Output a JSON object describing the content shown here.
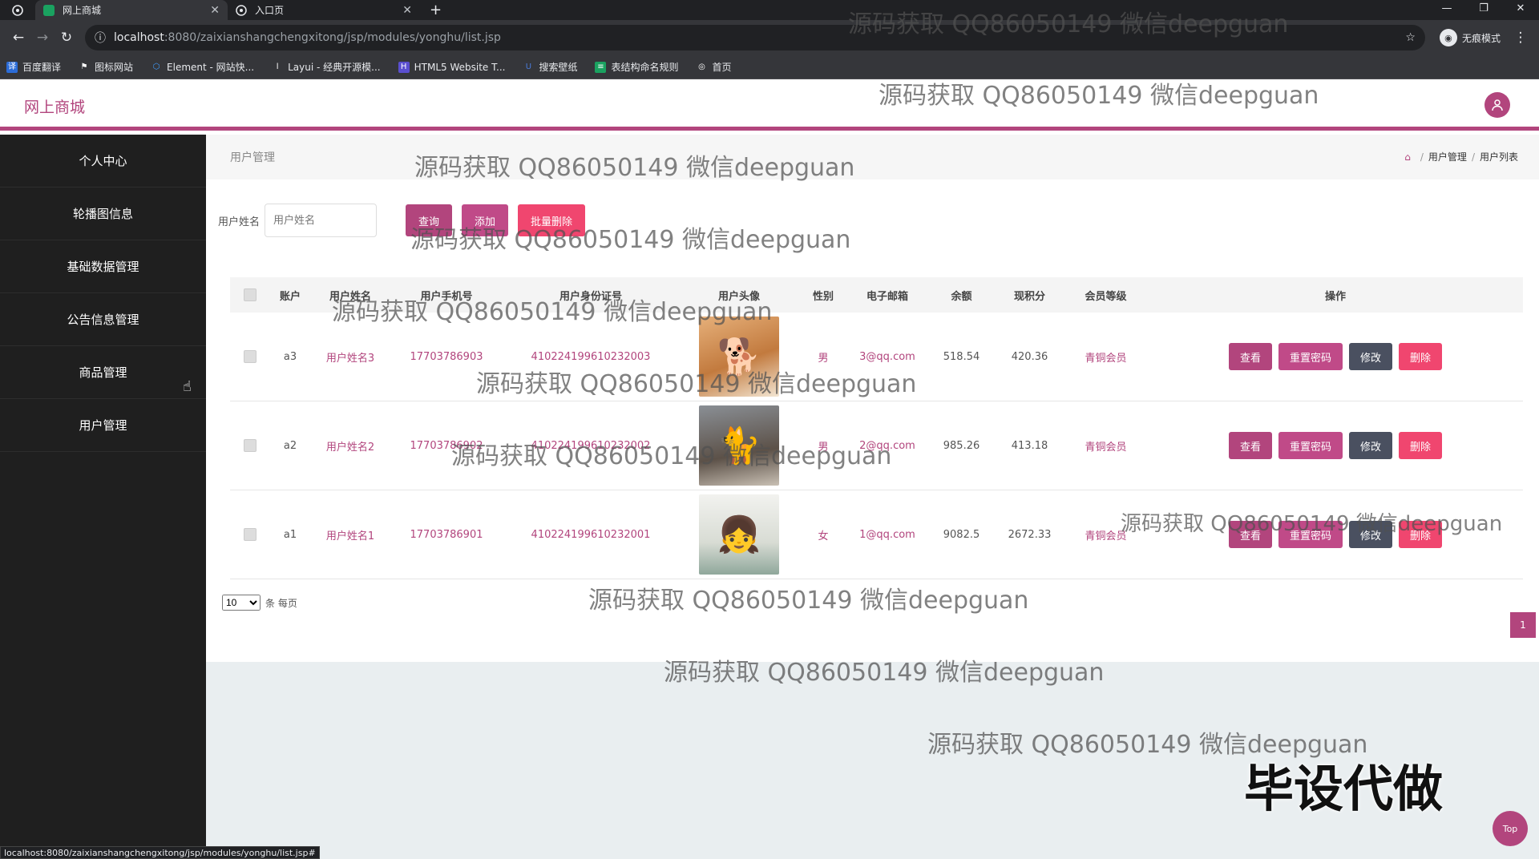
{
  "browser": {
    "tabs": [
      {
        "title": "网上商城",
        "active": true
      },
      {
        "title": "入口页",
        "active": false
      }
    ],
    "url_host": "localhost",
    "url_path": ":8080/zaixianshangchengxitong/jsp/modules/yonghu/list.jsp",
    "incognito_label": "无痕模式",
    "bookmarks": [
      "百度翻译",
      "图标网站",
      "Element - 网站快...",
      "Layui - 经典开源模...",
      "HTML5 Website T...",
      "搜索壁纸",
      "表结构命名规则",
      "首页"
    ],
    "status_url": "localhost:8080/zaixianshangchengxitong/jsp/modules/yonghu/list.jsp#"
  },
  "header": {
    "brand": "网上商城"
  },
  "sidebar": {
    "items": [
      {
        "label": "个人中心"
      },
      {
        "label": "轮播图信息"
      },
      {
        "label": "基础数据管理"
      },
      {
        "label": "公告信息管理"
      },
      {
        "label": "商品管理"
      },
      {
        "label": "用户管理"
      }
    ]
  },
  "page": {
    "title": "用户管理",
    "breadcrumb": [
      "用户管理",
      "用户列表"
    ]
  },
  "search": {
    "label": "用户姓名",
    "placeholder": "用户姓名",
    "query_label": "查询",
    "add_label": "添加",
    "batch_delete_label": "批量删除"
  },
  "table": {
    "headers": [
      "账户",
      "用户姓名",
      "用户手机号",
      "用户身份证号",
      "用户头像",
      "性别",
      "电子邮箱",
      "余额",
      "现积分",
      "会员等级",
      "操作"
    ],
    "rows": [
      {
        "account": "a3",
        "name": "用户姓名3",
        "phone": "17703786903",
        "id_card": "410224199610232003",
        "avatar": "shiba-dog",
        "sex": "男",
        "email": "3@qq.com",
        "balance": "518.54",
        "points": "420.36",
        "level": "青铜会员"
      },
      {
        "account": "a2",
        "name": "用户姓名2",
        "phone": "17703786902",
        "id_card": "410224199610232002",
        "avatar": "cat",
        "sex": "男",
        "email": "2@qq.com",
        "balance": "985.26",
        "points": "413.18",
        "level": "青铜会员"
      },
      {
        "account": "a1",
        "name": "用户姓名1",
        "phone": "17703786901",
        "id_card": "410224199610232001",
        "avatar": "girl-portrait",
        "sex": "女",
        "email": "1@qq.com",
        "balance": "9082.5",
        "points": "2672.33",
        "level": "青铜会员"
      }
    ],
    "ops": {
      "view": "查看",
      "reset": "重置密码",
      "edit": "修改",
      "delete": "删除"
    }
  },
  "pager": {
    "size": "10",
    "size_suffix": "条 每页",
    "current_page": "1"
  },
  "overlays": {
    "watermark": "源码获取 QQ86050149 微信deepguan",
    "stamp": "毕设代做",
    "top_button": "Top"
  },
  "colors": {
    "accent": "#b2457d",
    "danger": "#f0466f",
    "sidebar": "#1f1f1f"
  }
}
